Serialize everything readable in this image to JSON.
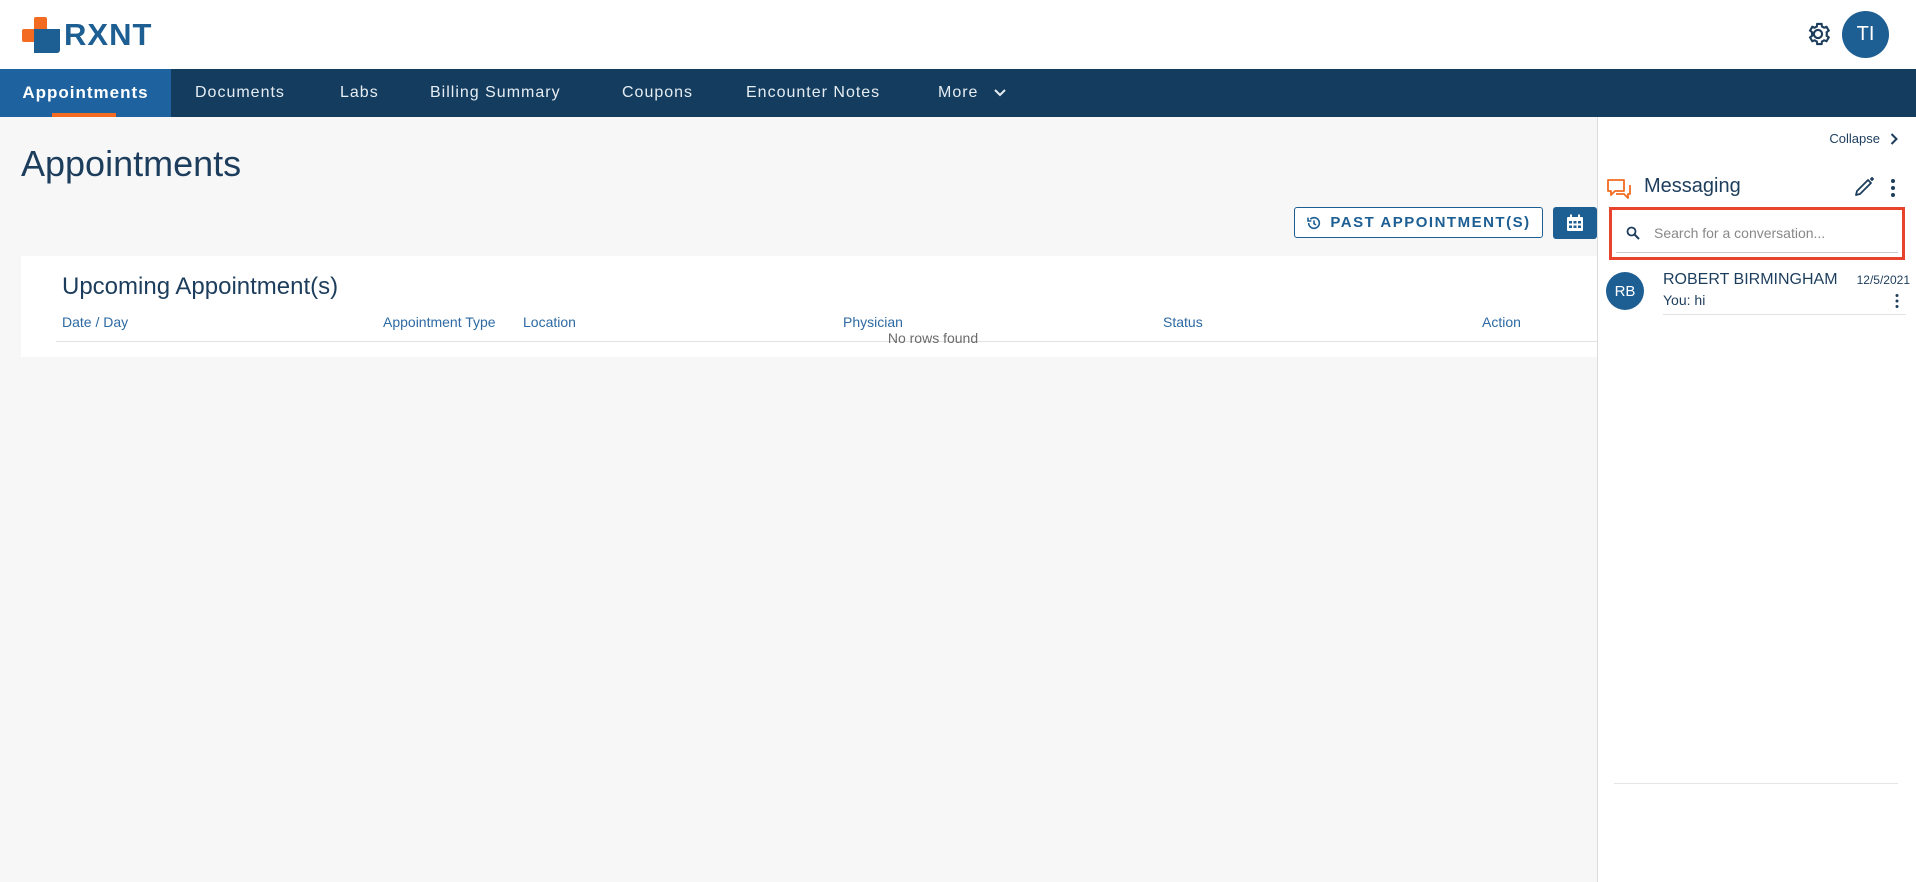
{
  "brand": {
    "name": "RXNT",
    "accent": "#f26b21",
    "primary": "#1d5e93"
  },
  "header": {
    "user_initials": "TI",
    "settings_icon": "gear-icon"
  },
  "nav": {
    "items": [
      "Appointments",
      "Documents",
      "Labs",
      "Billing Summary",
      "Coupons",
      "Encounter Notes",
      "More"
    ],
    "active": "Appointments"
  },
  "main": {
    "title": "Appointments",
    "past_button": "PAST APPOINTMENT(S)",
    "card": {
      "title": "Upcoming Appointment(s)",
      "columns": [
        "Date / Day",
        "Appointment Type",
        "Location",
        "Physician",
        "Status",
        "Action"
      ],
      "empty_text": "No rows found"
    }
  },
  "messaging": {
    "collapse_label": "Collapse",
    "title": "Messaging",
    "search_placeholder": "Search for a conversation...",
    "conversations": [
      {
        "initials": "RB",
        "name": "ROBERT BIRMINGHAM",
        "date": "12/5/2021",
        "last_message": "You: hi"
      }
    ]
  }
}
